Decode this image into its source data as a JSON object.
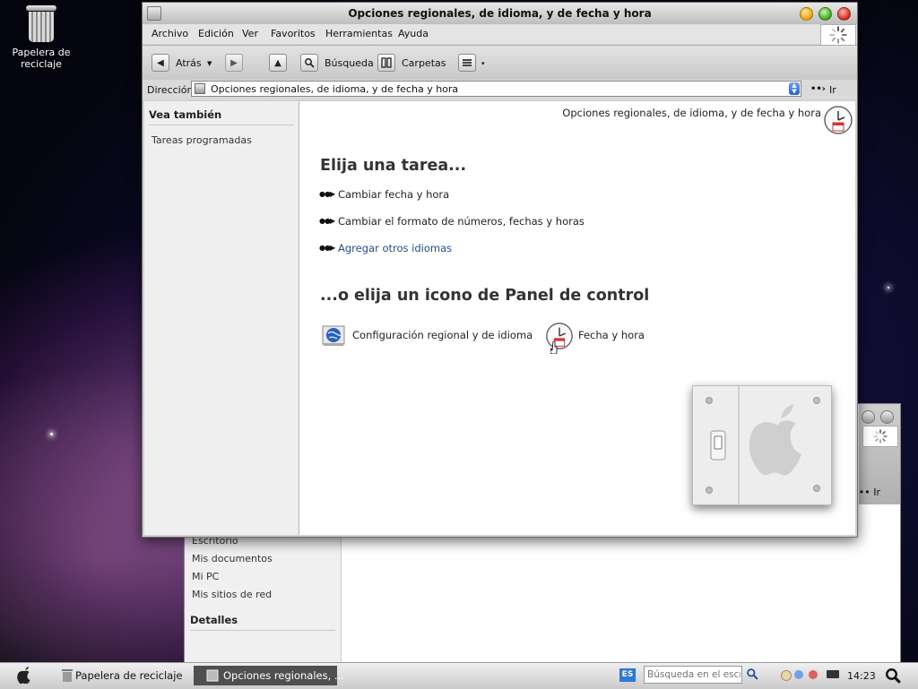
{
  "desktop": {
    "recycle_bin_label": "Papelera de reciclaje"
  },
  "background_window": {
    "links": [
      "Escritorio",
      "Mis documentos",
      "Mi PC",
      "Mis sitios de red"
    ],
    "details_heading": "Detalles",
    "go_label": "Ir"
  },
  "window": {
    "title": "Opciones regionales, de idioma, y de fecha y hora",
    "menu": [
      "Archivo",
      "Edición",
      "Ver",
      "Favoritos",
      "Herramientas",
      "Ayuda"
    ],
    "toolbar": {
      "back_label": "Atrás",
      "search_label": "Búsqueda",
      "folders_label": "Carpetas"
    },
    "address": {
      "label": "Dirección",
      "value": "Opciones regionales, de idioma, y de fecha y hora",
      "go_label": "Ir"
    },
    "sidebar": {
      "heading": "Vea también",
      "links": [
        "Tareas programadas"
      ]
    },
    "content": {
      "title": "Opciones regionales, de idioma, y de fecha y hora",
      "task_heading": "Elija una tarea...",
      "tasks": [
        "Cambiar fecha y hora",
        "Cambiar el formato de números, fechas y horas",
        "Agregar otros idiomas"
      ],
      "icons_heading": "...o elija un icono de Panel de control",
      "icons": [
        "Configuración regional y de idioma",
        "Fecha y hora"
      ]
    }
  },
  "taskbar": {
    "tasks": [
      "Papelera de reciclaje",
      "Opciones regionales, ..."
    ],
    "language": "ES",
    "search_placeholder": "Búsqueda en el escritorio",
    "clock": "14:23"
  },
  "colors": {
    "link_hover": "#1d4e9e",
    "active_task": "#4f4f4f",
    "language_badge": "#2c7ad8"
  }
}
